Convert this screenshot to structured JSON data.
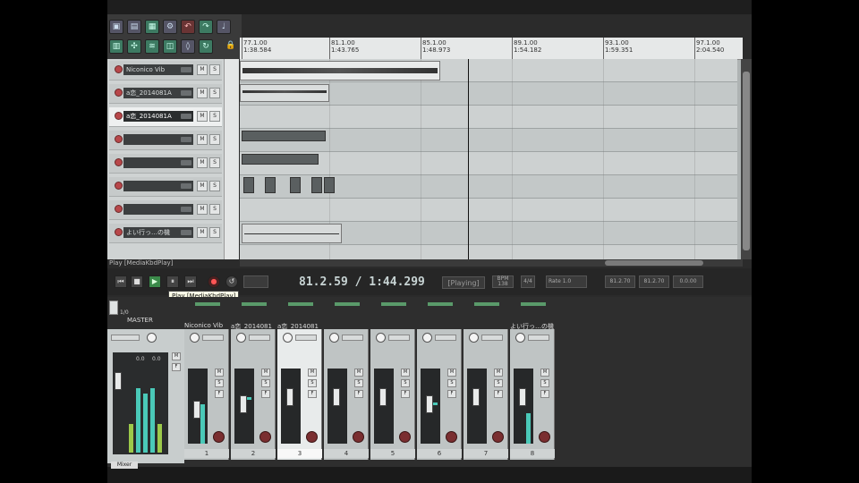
{
  "ruler": {
    "marks": [
      {
        "bar": "77.1.00",
        "time": "1:38.584"
      },
      {
        "bar": "81.1.00",
        "time": "1:43.765"
      },
      {
        "bar": "85.1.00",
        "time": "1:48.973"
      },
      {
        "bar": "89.1.00",
        "time": "1:54.182"
      },
      {
        "bar": "93.1.00",
        "time": "1:59.351"
      },
      {
        "bar": "97.1.00",
        "time": "2:04.540"
      }
    ]
  },
  "tracks": [
    {
      "name": "Niconico Vib"
    },
    {
      "name": "a恋_2014081A"
    },
    {
      "name": "a恋_2014081A"
    },
    {
      "name": ""
    },
    {
      "name": ""
    },
    {
      "name": ""
    },
    {
      "name": ""
    },
    {
      "name": "よい行っ…の機"
    }
  ],
  "status_text": "Play [MediaKbdPlay]",
  "transport": {
    "time_display": "81.2.59 / 1:44.299",
    "state": "[Playing]",
    "bpm_label": "BPM",
    "bpm_value": "138",
    "rate_label": "Rate",
    "rate_value": "1.0",
    "sel_start": "81.2.70",
    "sel_end": "81.2.70",
    "sel_len": "0.0.00"
  },
  "tooltip": "Play [MediaKbdPlay]",
  "mixer": {
    "master_label": "MASTER",
    "master_peaks": [
      "0.0",
      "0.0"
    ],
    "io_label": "1/0",
    "mixer_tab": "Mixer",
    "channels": [
      {
        "name": "Niconico Vib",
        "num": "1"
      },
      {
        "name": "a恋_2014081",
        "num": "2"
      },
      {
        "name": "a恋_2014081",
        "num": "3"
      },
      {
        "name": "",
        "num": "4"
      },
      {
        "name": "",
        "num": "5"
      },
      {
        "name": "",
        "num": "6"
      },
      {
        "name": "",
        "num": "7"
      },
      {
        "name": "よい行っ…の機",
        "num": "8"
      }
    ]
  },
  "colors": {
    "accent": "#4ac9b8",
    "play": "#3b8a4a",
    "rec": "#b8474a"
  }
}
